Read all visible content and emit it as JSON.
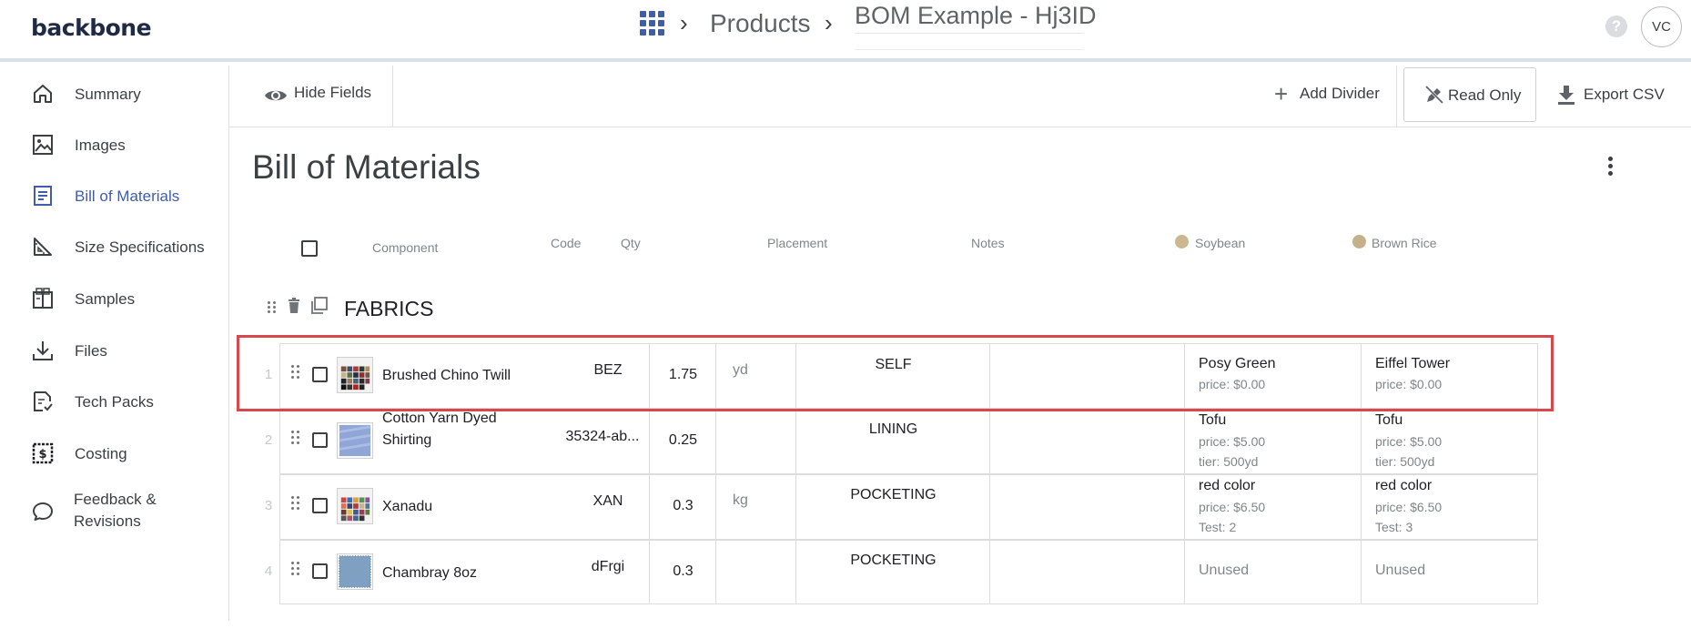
{
  "app": {
    "logo": "backbone",
    "breadcrumb": {
      "products": "Products",
      "current": "BOM Example - Hj3ID"
    },
    "help_icon": "?",
    "avatar_initials": "VC"
  },
  "sidebar": {
    "items": [
      {
        "label": "Summary",
        "icon": "home-icon"
      },
      {
        "label": "Images",
        "icon": "image-icon"
      },
      {
        "label": "Bill of Materials",
        "icon": "receipt-icon",
        "active": true
      },
      {
        "label": "Size Specifications",
        "icon": "ruler-icon"
      },
      {
        "label": "Samples",
        "icon": "package-icon"
      },
      {
        "label": "Files",
        "icon": "download-icon"
      },
      {
        "label": "Tech Packs",
        "icon": "file-check-icon"
      },
      {
        "label": "Costing",
        "icon": "dollar-icon"
      },
      {
        "label": "Feedback & Revisions",
        "label_line1": "Feedback &",
        "label_line2": "Revisions",
        "icon": "chat-icon"
      }
    ]
  },
  "toolbar": {
    "hide_fields": "Hide Fields",
    "add_divider": "Add Divider",
    "read_only": "Read Only",
    "export_csv": "Export CSV"
  },
  "page": {
    "title": "Bill of Materials"
  },
  "table": {
    "headers": {
      "component": "Component",
      "code": "Code",
      "qty": "Qty",
      "placement": "Placement",
      "notes": "Notes",
      "color1": "Soybean",
      "color2": "Brown Rice"
    },
    "colors": {
      "soybean": "#cbb88e",
      "brown_rice": "#c4b08a",
      "highlight": "#d7484d",
      "accent": "#3f5ea8"
    },
    "group_title": "FABRICS",
    "rows": [
      {
        "num": "1",
        "component": "Brushed Chino Twill",
        "code": "BEZ",
        "qty": "1.75",
        "unit": "yd",
        "placement": "SELF",
        "c1_name": "Posy Green",
        "c1_price": "price: $0.00",
        "c2_name": "Eiffel Tower",
        "c2_price": "price: $0.00"
      },
      {
        "num": "2",
        "component_line1": "Cotton Yarn Dyed",
        "component_line2": "Shirting",
        "code": "35324-ab...",
        "qty": "0.25",
        "unit": "",
        "placement": "LINING",
        "c1_name": "Tofu",
        "c1_price": "price: $5.00",
        "c1_extra": "tier: 500yd",
        "c2_name": "Tofu",
        "c2_price": "price: $5.00",
        "c2_extra": "tier: 500yd"
      },
      {
        "num": "3",
        "component": "Xanadu",
        "code": "XAN",
        "qty": "0.3",
        "unit": "kg",
        "placement": "POCKETING",
        "c1_name": "red color",
        "c1_price": "price: $6.50",
        "c1_extra": "Test: 2",
        "c2_name": "red color",
        "c2_price": "price: $6.50",
        "c2_extra": "Test: 3"
      },
      {
        "num": "4",
        "component": "Chambray 8oz",
        "code": "dFrgi",
        "qty": "0.3",
        "unit": "",
        "placement": "POCKETING",
        "c1_unused": "Unused",
        "c2_unused": "Unused"
      }
    ]
  }
}
